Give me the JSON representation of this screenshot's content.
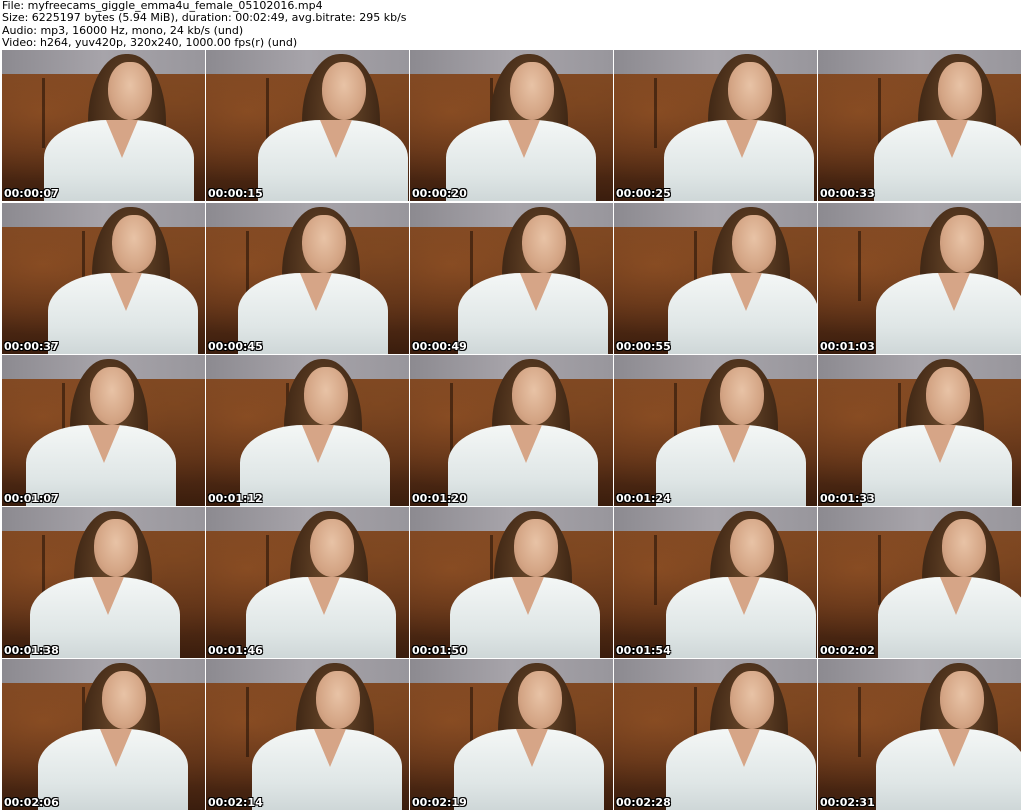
{
  "header": {
    "line1": "File: myfreecams_giggle_emma4u_female_05102016.mp4",
    "line2": "Size: 6225197 bytes (5.94 MiB), duration: 00:02:49, avg.bitrate: 295 kb/s",
    "line3": "Audio: mp3, 16000 Hz, mono, 24 kb/s (und)",
    "line4": "Video: h264, yuv420p, 320x240, 1000.00 fps(r) (und)"
  },
  "timestamps": [
    "00:00:07",
    "00:00:15",
    "00:00:20",
    "00:00:25",
    "00:00:33",
    "00:00:37",
    "00:00:45",
    "00:00:49",
    "00:00:55",
    "00:01:03",
    "00:01:07",
    "00:01:12",
    "00:01:20",
    "00:01:24",
    "00:01:33",
    "00:01:38",
    "00:01:46",
    "00:01:50",
    "00:01:54",
    "00:02:02",
    "00:02:06",
    "00:02:14",
    "00:02:19",
    "00:02:28",
    "00:02:31"
  ]
}
